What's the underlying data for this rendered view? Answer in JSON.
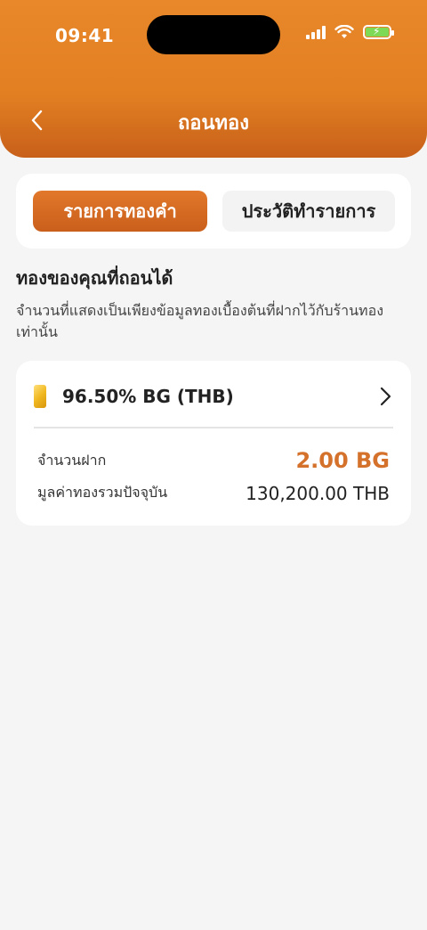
{
  "status_bar": {
    "time": "09:41"
  },
  "header": {
    "title": "ถอนทอง"
  },
  "tabs": [
    {
      "label": "รายการทองคำ",
      "active": true
    },
    {
      "label": "ประวัติทำรายการ",
      "active": false
    }
  ],
  "section": {
    "title": "ทองของคุณที่ถอนได้",
    "description": "จำนวนที่แสดงเป็นเพียงข้อมูลทองเบื้องต้นที่ฝากไว้กับร้านทองเท่านั้น"
  },
  "gold_item": {
    "name": "96.50% BG (THB)",
    "deposit_label": "จำนวนฝาก",
    "deposit_value": "2.00 BG",
    "total_label": "มูลค่าทองรวมปัจจุบัน",
    "total_value": "130,200.00 THB"
  },
  "colors": {
    "brand": "#e2802a",
    "accent_text": "#d4712a",
    "battery": "#7ed957"
  },
  "icons": {
    "back": "chevron-left-icon",
    "gold": "gold-bar-icon",
    "more": "chevron-right-icon"
  }
}
